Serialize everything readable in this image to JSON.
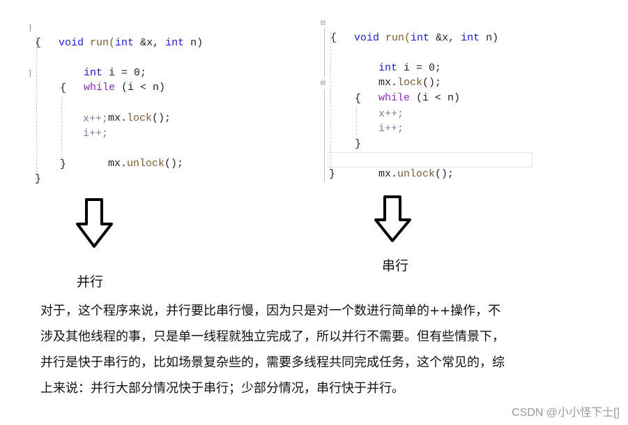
{
  "left_code": {
    "lines": [
      [
        "void",
        " run(",
        "int",
        " &x, ",
        "int",
        " n)"
      ],
      "{",
      [
        "int",
        " i = 0;"
      ],
      [
        "while",
        " (i < n)"
      ],
      "{",
      [
        "mx.",
        "lock",
        "();"
      ],
      "x++;",
      "i++;",
      [
        "mx.",
        "unlock",
        "();"
      ],
      "}",
      "}"
    ]
  },
  "right_code": {
    "lines": [
      [
        "void",
        " run(",
        "int",
        " &x, ",
        "int",
        " n)"
      ],
      "{",
      [
        "int",
        " i = 0;"
      ],
      [
        "mx.",
        "lock",
        "();"
      ],
      [
        "while",
        " (i < n)"
      ],
      "{",
      "x++;",
      "i++;",
      "}",
      [
        "mx.",
        "unlock",
        "();"
      ],
      "}"
    ]
  },
  "labels": {
    "parallel": "并行",
    "serial": "串行"
  },
  "paragraph": [
    "对于，这个程序来说，并行要比串行慢，因为只是对一个数进行简单的++操作，不",
    "涉及其他线程的事，只是单一线程就独立完成了，所以并行不需要。但有些情景下，",
    "并行是快于串行的，比如场景复杂些的，需要多线程共同完成任务，这个常见的，综",
    "上来说：并行大部分情况快于串行；少部分情况，串行快于并行。"
  ],
  "watermark": "CSDN @小小怪下士[]",
  "icons": {
    "arrow_left": "down-arrow-icon",
    "arrow_right": "down-arrow-icon"
  },
  "colors": {
    "keyword": "#1a1ad6",
    "while_keyword": "#8a2bb5",
    "function": "#7a5a2a",
    "variable": "#7b7b9a"
  }
}
